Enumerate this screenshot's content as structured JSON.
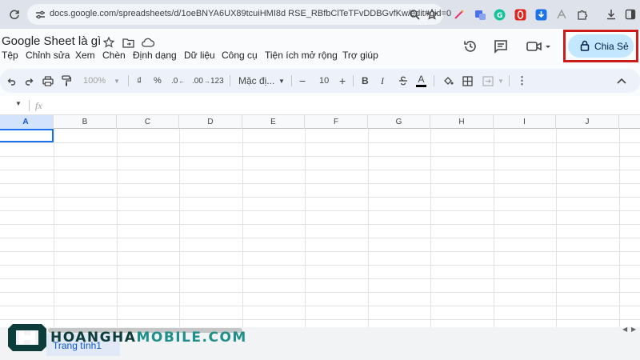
{
  "browser": {
    "url": "docs.google.com/spreadsheets/d/1oeBNYA6UX89tcuiHMI8d RSE_RBfbClTeTFvDDBGvfKw/edit#gid=0"
  },
  "header": {
    "doc_title": "Google Sheet là gì",
    "menu": [
      "Tệp",
      "Chỉnh sửa",
      "Xem",
      "Chèn",
      "Định dạng",
      "Dữ liệu",
      "Công cụ",
      "Tiện ích mở rộng",
      "Trợ giúp"
    ],
    "share_label": "Chia Sẻ"
  },
  "toolbar": {
    "zoom": "100%",
    "currency": "₫",
    "percent": "%",
    "decrease_decimal": ".0",
    "increase_decimal": ".00",
    "number_format": "123",
    "font": "Mặc đị...",
    "font_size": "10",
    "bold": "B",
    "italic": "I",
    "text_color": "A"
  },
  "formula_bar": {
    "fx": "fx"
  },
  "grid": {
    "columns": [
      "A",
      "B",
      "C",
      "D",
      "E",
      "F",
      "G",
      "H",
      "I",
      "J"
    ],
    "selected_column": "A"
  },
  "sheet_tabs": {
    "active": "Trang tính1"
  },
  "watermark": {
    "part1": "HOANGHA",
    "part2": "MOBILE.COM"
  },
  "colors": {
    "share_bg": "#c2e7ff",
    "share_highlight": "#cc1b1b",
    "selection": "#1a73e8",
    "watermark_dark": "#0d3d3b",
    "watermark_accent": "#1f8f8b"
  }
}
